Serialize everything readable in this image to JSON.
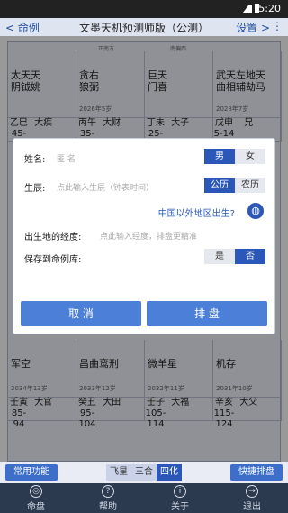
{
  "status": {
    "time": "5:20"
  },
  "topbar": {
    "back_label": "< 命例",
    "title": "文墨天机预测师版（公测）",
    "settings_label": "设置 >"
  },
  "chart": {
    "top_labels": [
      "正南方",
      "南偏西"
    ],
    "cells": [
      {
        "stars": "太天天\n阴钺姚",
        "marks": "D",
        "branch": "乙巳",
        "palace": "大疾",
        "range": "45-54"
      },
      {
        "stars": "贪右\n狼弼",
        "age": "2026年5岁",
        "branch": "丙午",
        "palace": "大财",
        "range": "35-44"
      },
      {
        "stars": "巨天\n门喜",
        "marks": "B B",
        "branch": "丁未",
        "palace": "大子",
        "range": "25-34"
      },
      {
        "stars": "武天左地天\n曲相辅劫马",
        "marks": "D C",
        "age": "2028年7岁",
        "branch": "戊申",
        "palace": "兄",
        "range": "5-14"
      }
    ],
    "bottom_cells": [
      {
        "stars": "军空",
        "age": "2034年13岁",
        "branch": "壬寅",
        "palace": "大官",
        "range": "85-94"
      },
      {
        "stars": "昌曲鸾刑",
        "age": "2033年12岁",
        "branch": "癸丑",
        "palace": "大田",
        "range": "95-104"
      },
      {
        "stars": "微羊星",
        "marks": "B",
        "age": "2032年11岁",
        "branch": "壬子",
        "palace": "大福",
        "range": "105-114"
      },
      {
        "stars": "机存",
        "age": "2031年10岁",
        "branch": "辛亥",
        "palace": "大父",
        "range": "115-124"
      }
    ]
  },
  "dialog": {
    "name_label": "姓名:",
    "name_placeholder": "匿 名",
    "gender": [
      "男",
      "女"
    ],
    "birth_label": "生辰:",
    "birth_placeholder": "点此输入生辰（钟表时间）",
    "calendar": [
      "公历",
      "农历"
    ],
    "abroad_link": "中国以外地区出生?",
    "longitude_label": "出生地的经度:",
    "longitude_placeholder": "点此输入经度，排盘更精准",
    "save_label": "保存到命例库:",
    "save_options": [
      "是",
      "否"
    ],
    "cancel": "取 消",
    "confirm": "排 盘"
  },
  "toolbar": {
    "left": "常用功能",
    "mid": [
      "飞星",
      "三合",
      "四化"
    ],
    "right": "快捷排盘"
  },
  "nav": [
    "命盘",
    "帮助",
    "关于",
    "退出"
  ]
}
